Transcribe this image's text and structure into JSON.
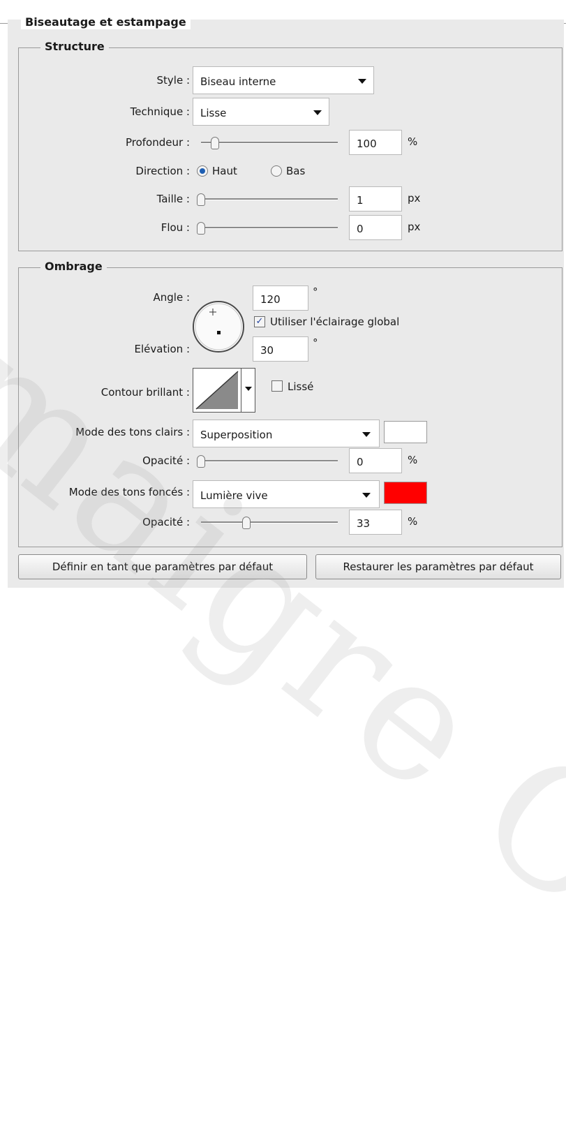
{
  "sections": {
    "main_title": "Biseautage et estampage",
    "structure_title": "Structure",
    "shading_title": "Ombrage"
  },
  "structure": {
    "style_label": "Style :",
    "style_value": "Biseau interne",
    "technique_label": "Technique :",
    "technique_value": "Lisse",
    "depth_label": "Profondeur :",
    "depth_value": "100",
    "depth_unit": "%",
    "direction_label": "Direction :",
    "direction_up": "Haut",
    "direction_down": "Bas",
    "size_label": "Taille :",
    "size_value": "1",
    "size_unit": "px",
    "soften_label": "Flou :",
    "soften_value": "0",
    "soften_unit": "px"
  },
  "shading": {
    "angle_label": "Angle :",
    "angle_value": "120",
    "degree_symbol": "°",
    "global_light_label": "Utiliser l'éclairage global",
    "global_light_checked": true,
    "altitude_label": "Elévation :",
    "altitude_value": "30",
    "gloss_label": "Contour brillant :",
    "antialias_label": "Lissé",
    "antialias_checked": false,
    "highlight_mode_label": "Mode des tons clairs :",
    "highlight_mode_value": "Superposition",
    "highlight_color": "#ffffff",
    "highlight_opacity_label": "Opacité :",
    "highlight_opacity_value": "0",
    "highlight_opacity_unit": "%",
    "shadow_mode_label": "Mode des tons foncés :",
    "shadow_mode_value": "Lumière vive",
    "shadow_color": "#ff0000",
    "shadow_opacity_label": "Opacité :",
    "shadow_opacity_value": "33",
    "shadow_opacity_unit": "%"
  },
  "slider_levels": {
    "depth": 0.1,
    "size": 0.0,
    "soften": 0.0,
    "highlight_opacity": 0.0,
    "shadow_opacity": 0.33
  },
  "buttons": {
    "set_default": "Définir en tant que paramètres par défaut",
    "reset_default": "Restaurer les paramètres par défaut"
  },
  "watermark": "maigre Copy",
  "colors": {
    "panel_bg": "#eaeaea",
    "radio_accent": "#1f5fb3"
  }
}
